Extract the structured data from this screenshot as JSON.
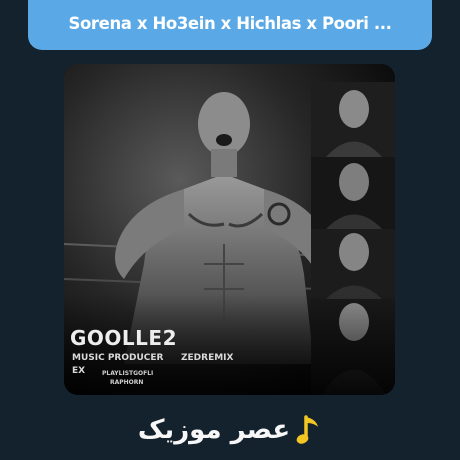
{
  "header": {
    "title": "Sorena x Ho3ein x Hichlas x Poori ..."
  },
  "cover": {
    "album_title": "GOOLLE2",
    "credits": {
      "line1_left": "MUSIC PRODUCER",
      "line1_right": "ZEDREMIX",
      "line2_left": "EX",
      "line3": "PLAYLISTGOFLI",
      "line4": "RAPHORN"
    }
  },
  "footer": {
    "brand_name": "عصر موزیک",
    "brand_icon": "music-note-icon",
    "brand_icon_color": "#f3c623"
  },
  "colors": {
    "background": "#14222e",
    "title_bar": "#5aa9e6"
  }
}
